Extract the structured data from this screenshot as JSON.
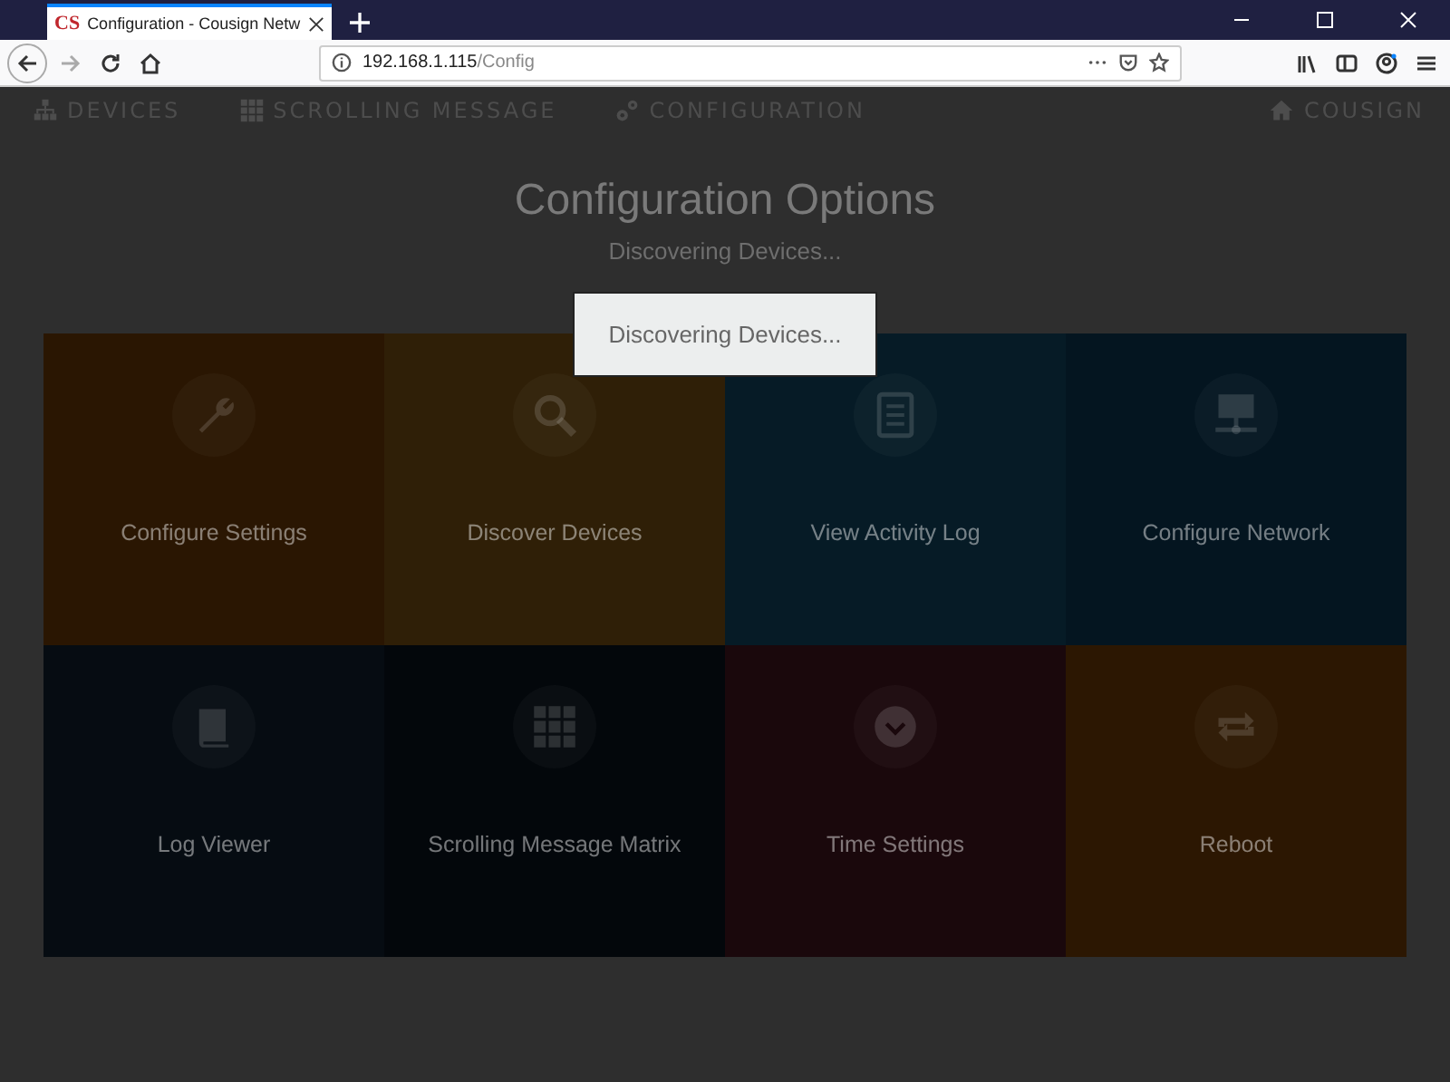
{
  "browser": {
    "favicon": "CS",
    "tab_title": "Configuration - Cousign Netw",
    "url_host": "192.168.1.115",
    "url_path": "/Config"
  },
  "nav": {
    "items": [
      {
        "label": "DEVICES"
      },
      {
        "label": "SCROLLING MESSAGE"
      },
      {
        "label": "CONFIGURATION"
      }
    ],
    "brand": "COUSIGN"
  },
  "page": {
    "title": "Configuration Options",
    "subtitle": "Discovering Devices..."
  },
  "tiles": [
    {
      "label": "Configure Settings",
      "color": "#2a1602"
    },
    {
      "label": "Discover Devices",
      "color": "#2f1f07"
    },
    {
      "label": "View Activity Log",
      "color": "#061b26"
    },
    {
      "label": "Configure Network",
      "color": "#041520"
    },
    {
      "label": "Log Viewer",
      "color": "#060c12"
    },
    {
      "label": "Scrolling Message Matrix",
      "color": "#03070b"
    },
    {
      "label": "Time Settings",
      "color": "#1a080c"
    },
    {
      "label": "Reboot",
      "color": "#2c1702"
    }
  ],
  "dialog": {
    "message": "Discovering Devices..."
  }
}
